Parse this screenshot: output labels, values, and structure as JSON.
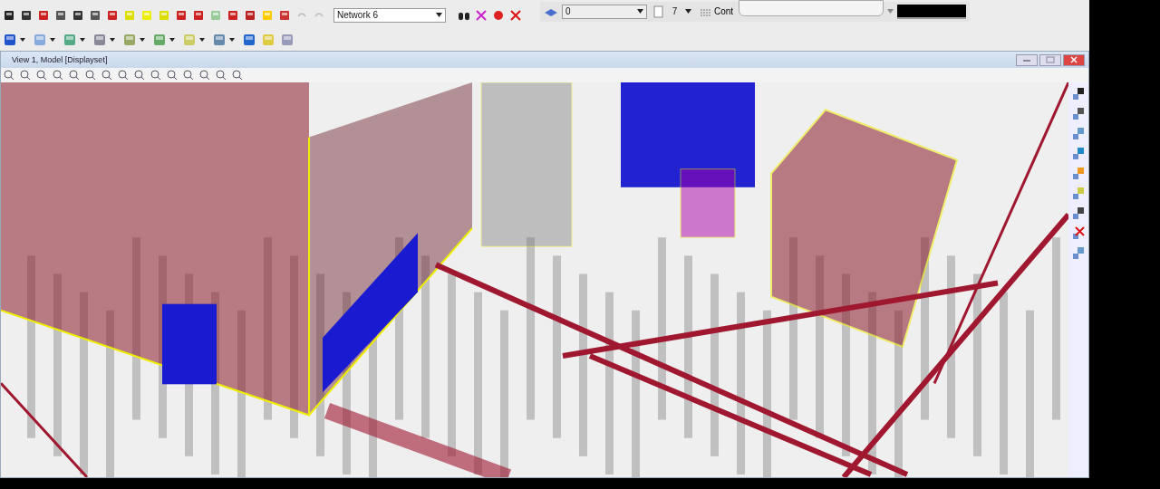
{
  "main_toolbar": {
    "network_dropdown": {
      "value": "Network 6"
    }
  },
  "properties_toolbar": {
    "level_dropdown": {
      "value": "0"
    },
    "weight_dropdown": {
      "value": "7"
    },
    "contour_button": {
      "label": "Cont"
    }
  },
  "view_window": {
    "title": "View 1, Model [Displayset]"
  }
}
